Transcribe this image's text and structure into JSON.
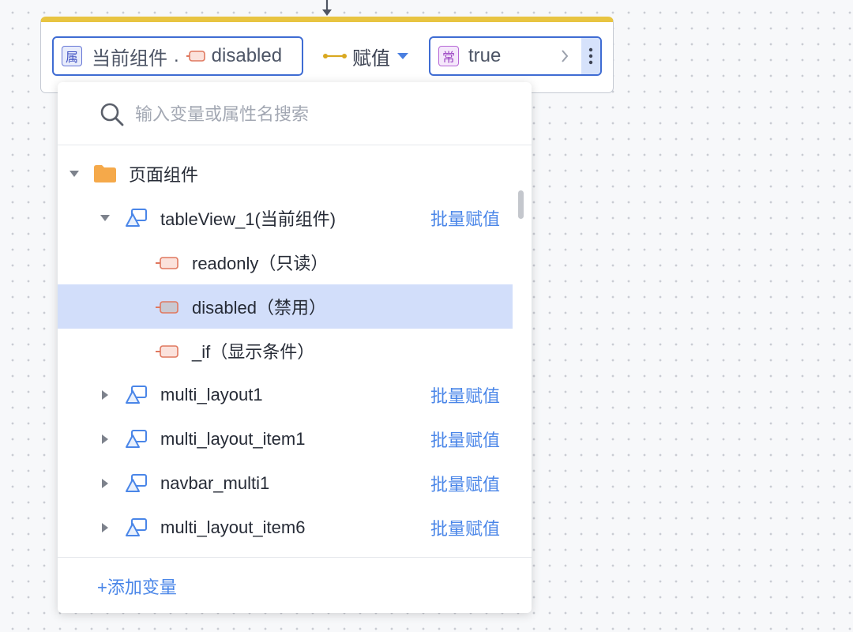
{
  "node": {
    "left_chip": {
      "badge": "属",
      "object": "当前组件",
      "separator": ".",
      "property": "disabled",
      "property_icon": "property-icon"
    },
    "operator": {
      "label": "赋值",
      "icon": "assign-link-icon",
      "caret_icon": "caret-down-icon"
    },
    "right_chip": {
      "badge": "常",
      "value": "true",
      "expand_icon": "chevron-right-icon",
      "more_icon": "more-vertical-icon"
    }
  },
  "dropdown": {
    "search": {
      "placeholder": "输入变量或属性名搜索",
      "value": "",
      "icon": "search-icon"
    },
    "tree": {
      "group": {
        "label": "页面组件",
        "icon": "folder-icon",
        "expanded": true
      },
      "components": [
        {
          "label": "tableView_1(当前组件)",
          "action": "批量赋值",
          "expanded": true,
          "icon": "component-icon",
          "properties": [
            {
              "label": "readonly（只读）",
              "selected": false
            },
            {
              "label": "disabled（禁用）",
              "selected": true
            },
            {
              "label": "_if（显示条件）",
              "selected": false
            }
          ]
        },
        {
          "label": "multi_layout1",
          "action": "批量赋值",
          "expanded": false,
          "icon": "component-icon"
        },
        {
          "label": "multi_layout_item1",
          "action": "批量赋值",
          "expanded": false,
          "icon": "component-icon"
        },
        {
          "label": "navbar_multi1",
          "action": "批量赋值",
          "expanded": false,
          "icon": "component-icon"
        },
        {
          "label": "multi_layout_item6",
          "action": "批量赋值",
          "expanded": false,
          "icon": "component-icon"
        }
      ]
    },
    "footer": {
      "add_variable": "+添加变量"
    }
  },
  "colors": {
    "node_header": "#e8c441",
    "chip_border": "#3f6cd3",
    "link_blue": "#4a86e8",
    "selected_row": "#d2defa",
    "property_icon": "#e0785f",
    "folder": "#f5a94a",
    "component_icon": "#4a86e8"
  }
}
